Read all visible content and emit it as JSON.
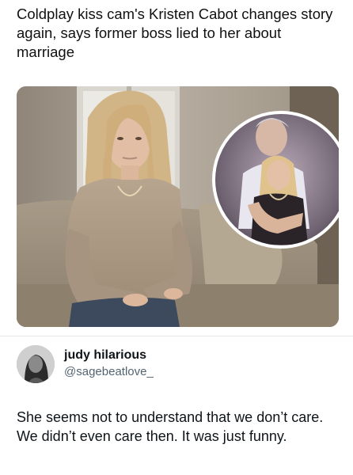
{
  "post": {
    "headline": "Coldplay kiss cam's Kristen Cabot changes story again, says former boss lied to her about marriage"
  },
  "reply": {
    "display_name": "judy hilarious",
    "handle": "@sagebeatlove_",
    "text": "She seems not to understand that we don’t care. We didn’t even care then. It was just funny."
  },
  "colors": {
    "text_primary": "#0f1419",
    "text_secondary": "#536471",
    "divider": "#e6e6e6"
  }
}
